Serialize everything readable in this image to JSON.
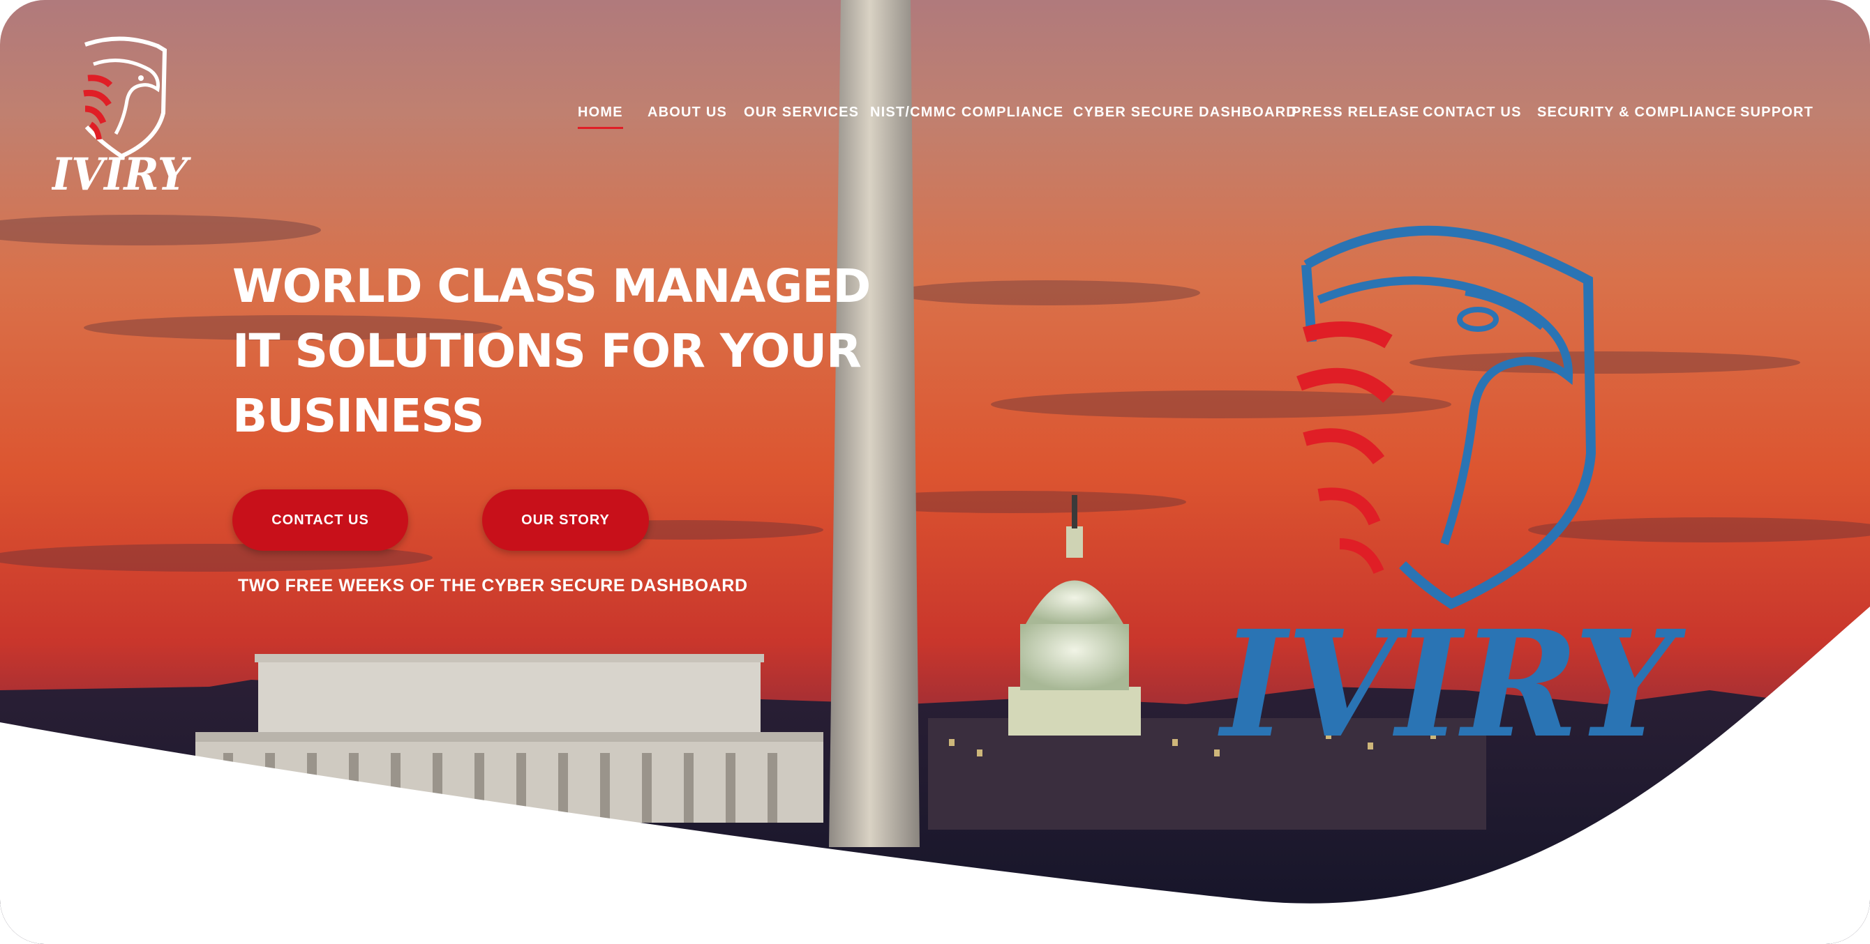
{
  "brand": {
    "name": "IVIRY",
    "colors": {
      "accent_red": "#c8101a",
      "logo_blue": "#2a74b4",
      "nav_underline": "#e01e26"
    }
  },
  "nav": {
    "items": [
      {
        "label": "HOME",
        "active": true
      },
      {
        "label": "ABOUT US",
        "active": false
      },
      {
        "label": "OUR SERVICES",
        "active": false
      },
      {
        "label": "NIST/CMMC COMPLIANCE",
        "active": false
      },
      {
        "label": "CYBER SECURE DASHBOARD",
        "active": false
      },
      {
        "label": "PRESS RELEASE",
        "active": false
      },
      {
        "label": "CONTACT US",
        "active": false
      },
      {
        "label": "SECURITY & COMPLIANCE",
        "active": false
      },
      {
        "label": "SUPPORT",
        "active": false
      }
    ]
  },
  "hero": {
    "title_lines": [
      "WORLD CLASS MANAGED",
      "IT SOLUTIONS FOR YOUR",
      "BUSINESS"
    ],
    "buttons": {
      "contact": "CONTACT US",
      "story": "OUR STORY"
    },
    "promo": "TWO FREE WEEKS OF THE CYBER SECURE DASHBOARD",
    "background_scene": "washington-dc-sunset-skyline"
  },
  "icons": [
    "eagle-shield-logo-icon"
  ]
}
